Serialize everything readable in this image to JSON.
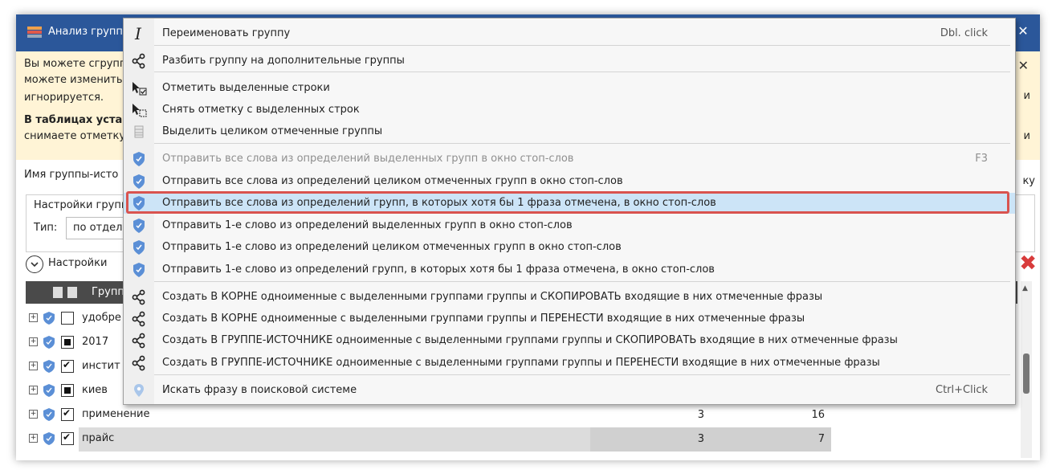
{
  "window": {
    "title": "Анализ групп",
    "close_glyph": "✕"
  },
  "info": {
    "line1": "Вы можете сгрупп",
    "line2": "можете изменить",
    "line3": "игнорируется.",
    "line4_bold": "В таблицах устан",
    "line5": "снимаете отметку",
    "right_frag1": "и",
    "right_frag2": "и",
    "close_glyph": "✕"
  },
  "form": {
    "source_group_label": "Имя группы-исто",
    "right_frag": "ку",
    "settings_group_label": "Настройки групп",
    "type_label": "Тип:",
    "type_value": "по отдел",
    "settings_toggle": "Настройки",
    "delete_glyph": "✖"
  },
  "grid": {
    "header_label": "Групп",
    "rows": [
      {
        "name": "удобре",
        "state": "empty",
        "v1": "",
        "v2": "",
        "selected": false
      },
      {
        "name": "2017",
        "state": "filled",
        "v1": "",
        "v2": "",
        "selected": false
      },
      {
        "name": "инстит",
        "state": "checked",
        "v1": "",
        "v2": "",
        "selected": false
      },
      {
        "name": "киев",
        "state": "filled",
        "v1": "",
        "v2": "",
        "selected": false
      },
      {
        "name": "применение",
        "state": "checked",
        "v1": "3",
        "v2": "16",
        "selected": false
      },
      {
        "name": "прайс",
        "state": "checked",
        "v1": "3",
        "v2": "7",
        "selected": true
      }
    ]
  },
  "menu": {
    "items": [
      {
        "id": "rename",
        "icon": "text-cursor-icon",
        "label": "Переименовать группу",
        "shortcut": "Dbl. click",
        "disabled": false
      },
      {
        "id": "split",
        "icon": "share-icon",
        "label": "Разбить группу на дополнительные группы",
        "shortcut": "",
        "disabled": false
      },
      {
        "id": "mark",
        "icon": "cursor-check-icon",
        "label": "Отметить выделенные строки",
        "shortcut": "",
        "disabled": false
      },
      {
        "id": "unmark",
        "icon": "cursor-uncheck-icon",
        "label": "Снять отметку с выделенных строк",
        "shortcut": "",
        "disabled": false
      },
      {
        "id": "select-marked",
        "icon": "table-icon",
        "label": "Выделить целиком отмеченные группы",
        "shortcut": "",
        "disabled": false
      },
      {
        "id": "stop-all-selected",
        "icon": "shield-icon",
        "label": "Отправить все слова из определений выделенных групп в окно стоп-слов",
        "shortcut": "F3",
        "disabled": true
      },
      {
        "id": "stop-all-marked",
        "icon": "shield-icon",
        "label": "Отправить все слова из определений целиком отмеченных групп в окно стоп-слов",
        "shortcut": "",
        "disabled": false
      },
      {
        "id": "stop-all-any",
        "icon": "shield-icon",
        "label": "Отправить все слова из определений групп, в которых хотя бы 1 фраза отмечена, в окно стоп-слов",
        "shortcut": "",
        "disabled": false
      },
      {
        "id": "stop-first-selected",
        "icon": "shield-icon",
        "label": "Отправить 1-е слово из определений выделенных групп в окно стоп-слов",
        "shortcut": "",
        "disabled": false
      },
      {
        "id": "stop-first-marked",
        "icon": "shield-icon",
        "label": "Отправить 1-е слово из определений целиком отмеченных групп в окно стоп-слов",
        "shortcut": "",
        "disabled": false
      },
      {
        "id": "stop-first-any",
        "icon": "shield-icon",
        "label": "Отправить 1-е слово из определений групп, в которых хотя бы 1 фраза отмечена, в окно стоп-слов",
        "shortcut": "",
        "disabled": false
      },
      {
        "id": "root-copy",
        "icon": "share-icon",
        "label": "Создать В КОРНЕ одноименные с выделенными группами группы и СКОПИРОВАТЬ входящие в них отмеченные фразы",
        "shortcut": "",
        "disabled": false
      },
      {
        "id": "root-move",
        "icon": "share-icon",
        "label": "Создать В КОРНЕ одноименные с выделенными группами группы и ПЕРЕНЕСТИ входящие в них отмеченные фразы",
        "shortcut": "",
        "disabled": false
      },
      {
        "id": "source-copy",
        "icon": "share-icon",
        "label": "Создать В ГРУППЕ-ИСТОЧНИКЕ одноименные с выделенными группами группы и СКОПИРОВАТЬ входящие в них отмеченные фразы",
        "shortcut": "",
        "disabled": false
      },
      {
        "id": "source-move",
        "icon": "share-icon",
        "label": "Создать В ГРУППЕ-ИСТОЧНИКЕ одноименные с выделенными группами группы и ПЕРЕНЕСТИ входящие в них отмеченные фразы",
        "shortcut": "",
        "disabled": false
      },
      {
        "id": "search",
        "icon": "map-pin-icon",
        "label": "Искать фразу в поисковой системе",
        "shortcut": "Ctrl+Click",
        "disabled": false
      }
    ],
    "highlighted": "stop-all-any"
  },
  "colors": {
    "titlebar": "#2b579a",
    "info_bg": "#fff4d6",
    "highlight_bg": "#cce4f7",
    "highlight_border": "#d9534f",
    "shield": "#5b8fd6"
  }
}
